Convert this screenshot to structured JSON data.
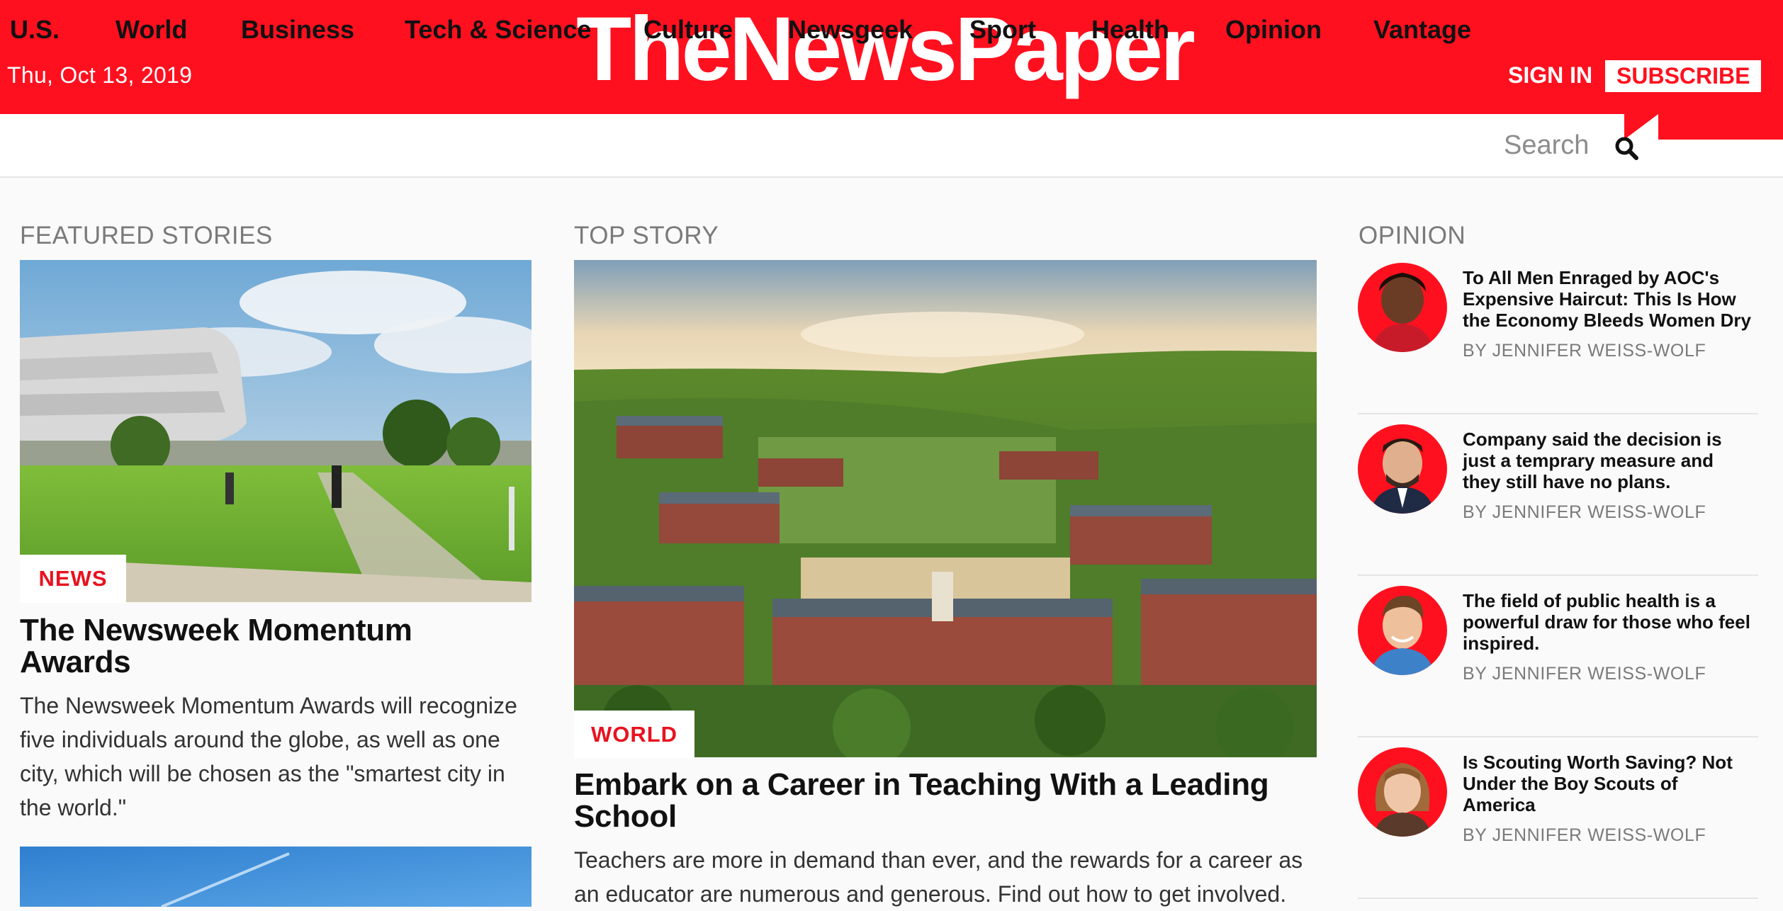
{
  "header": {
    "date": "Thu, Oct 13, 2019",
    "logo": "TheNewsPaper",
    "signin_label": "SIGN IN",
    "subscribe_label": "SUBSCRIBE",
    "brand_color": "#ff101f"
  },
  "nav": {
    "items": [
      "U.S.",
      "World",
      "Business",
      "Tech & Science",
      "Culture",
      "Newsgeek",
      "Sport",
      "Health",
      "Opinion",
      "Vantage"
    ],
    "search_placeholder": "Search",
    "search_icon": "search-icon"
  },
  "featured": {
    "section_title": "FEATURED STORIES",
    "tag": "NEWS",
    "headline": "The Newsweek Momentum Awards",
    "summary": "The Newsweek Momentum Awards will recognize five individuals around the globe, as well as one city, which will be chosen as the \"smartest city in the world.\""
  },
  "top_story": {
    "section_title": "TOP STORY",
    "tag": "WORLD",
    "headline": "Embark on a Career in Teaching With a Leading School",
    "summary": "Teachers are more in demand than ever, and the rewards for a career as an educator are numerous and generous. Find out how to get involved."
  },
  "opinion": {
    "section_title": "OPINION",
    "items": [
      {
        "title": "To All Men Enraged by AOC's Expensive Haircut: This Is How the Economy Bleeds Women Dry",
        "author": "BY JENNIFER WEISS-WOLF"
      },
      {
        "title": "Company said the decision is just a temprary measure and they still have no plans.",
        "author": "BY JENNIFER WEISS-WOLF"
      },
      {
        "title": "The field of public health is a powerful draw for those who feel inspired.",
        "author": "BY JENNIFER WEISS-WOLF"
      },
      {
        "title": "Is Scouting Worth Saving? Not Under the Boy Scouts of America",
        "author": "BY JENNIFER WEISS-WOLF"
      }
    ]
  }
}
